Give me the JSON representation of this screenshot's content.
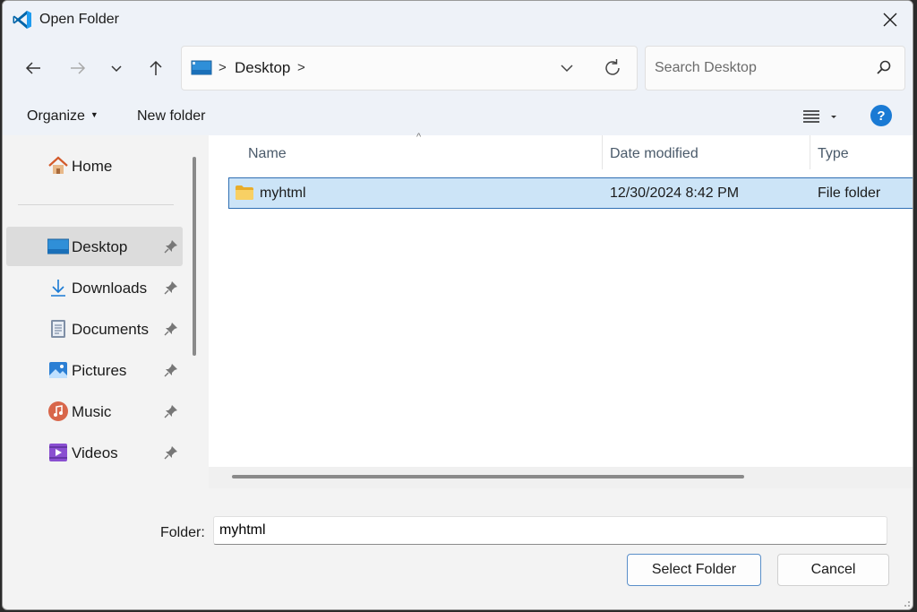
{
  "window": {
    "title": "Open Folder",
    "app_icon": "vscode-icon",
    "close_icon": "close-icon"
  },
  "nav": {
    "back_icon": "arrow-left-icon",
    "forward_icon": "arrow-right-icon",
    "recent_icon": "chevron-down-icon",
    "up_icon": "arrow-up-icon"
  },
  "address": {
    "location_icon": "desktop-icon",
    "separator": ">",
    "path": "Desktop",
    "trailing_separator": ">"
  },
  "search": {
    "placeholder": "Search Desktop",
    "icon": "search-icon"
  },
  "toolbar": {
    "organize_label": "Organize",
    "new_folder_label": "New folder",
    "view_icon": "view-list-icon",
    "help_icon": "help-icon"
  },
  "sidebar": {
    "home_label": "Home",
    "items": [
      {
        "label": "Desktop",
        "icon": "desktop-icon",
        "pinned": true,
        "selected": true
      },
      {
        "label": "Downloads",
        "icon": "download-icon",
        "pinned": true
      },
      {
        "label": "Documents",
        "icon": "document-icon",
        "pinned": true
      },
      {
        "label": "Pictures",
        "icon": "pictures-icon",
        "pinned": true
      },
      {
        "label": "Music",
        "icon": "music-icon",
        "pinned": true
      },
      {
        "label": "Videos",
        "icon": "videos-icon",
        "pinned": true
      }
    ]
  },
  "files": {
    "columns": [
      "Name",
      "Date modified",
      "Type"
    ],
    "rows": [
      {
        "name": "myhtml",
        "date": "12/30/2024 8:42 PM",
        "type": "File folder",
        "selected": true
      }
    ]
  },
  "footer": {
    "folder_label": "Folder:",
    "folder_value": "myhtml",
    "select_label": "Select Folder",
    "cancel_label": "Cancel"
  },
  "colors": {
    "accent": "#0067c0",
    "selection": "#cce4f7",
    "folder": "#f5c542"
  }
}
